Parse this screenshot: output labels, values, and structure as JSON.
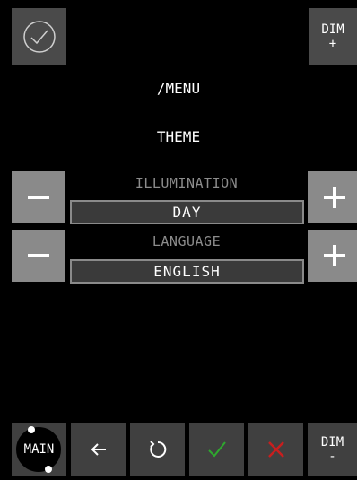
{
  "header": {
    "confirm_icon": "check-circle-icon",
    "dim_plus": {
      "label": "DIM",
      "sign": "+"
    }
  },
  "menu": {
    "path": "/MENU",
    "section": "THEME"
  },
  "settings": [
    {
      "label": "ILLUMINATION",
      "value": "DAY",
      "decrease_icon": "minus-icon",
      "increase_icon": "plus-icon"
    },
    {
      "label": "LANGUAGE",
      "value": "ENGLISH",
      "decrease_icon": "minus-icon",
      "increase_icon": "plus-icon"
    }
  ],
  "footer": {
    "main_label": "MAIN",
    "back_icon": "arrow-left-icon",
    "reset_icon": "rotate-icon",
    "accept_icon": "check-icon",
    "cancel_icon": "x-icon",
    "dim_minus": {
      "label": "DIM",
      "sign": "-"
    }
  },
  "colors": {
    "accept": "#2ea82e",
    "cancel": "#c81e1e",
    "button": "#4a4a4a",
    "stepper": "#8a8a8a"
  }
}
